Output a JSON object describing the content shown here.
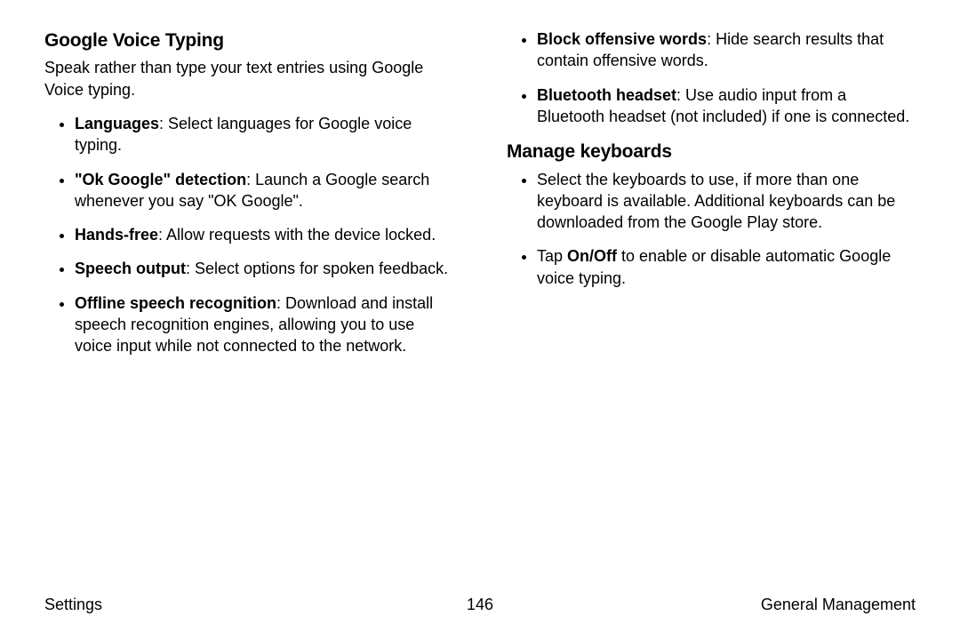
{
  "left": {
    "heading": "Google Voice Typing",
    "intro": "Speak rather than type your text entries using Google Voice typing.",
    "items": [
      {
        "label": "Languages",
        "desc": ": Select languages for Google voice typing."
      },
      {
        "label": "\"Ok Google\" detection",
        "desc": ": Launch a Google search whenever you say \"OK Google\"."
      },
      {
        "label": "Hands-free",
        "desc": ": Allow requests with the device locked."
      },
      {
        "label": "Speech output",
        "desc": ": Select options for spoken feedback."
      },
      {
        "label": "Offline speech recognition",
        "desc": ": Download and install speech recognition engines, allowing you to use voice input while not connected to the network."
      }
    ]
  },
  "right_top": [
    {
      "label": "Block offensive words",
      "desc": ": Hide search results that contain offensive words."
    },
    {
      "label": "Bluetooth headset",
      "desc": ": Use audio input from a Bluetooth headset (not included) if one is connected."
    }
  ],
  "manage": {
    "heading": "Manage keyboards",
    "items": [
      {
        "plain": "Select the keyboards to use, if more than one keyboard is available. Additional keyboards can be downloaded from the Google Play store."
      },
      {
        "pre": "Tap ",
        "bold": "On/Off",
        "post": " to enable or disable automatic Google voice typing."
      }
    ]
  },
  "footer": {
    "left": "Settings",
    "center": "146",
    "right": "General Management"
  }
}
